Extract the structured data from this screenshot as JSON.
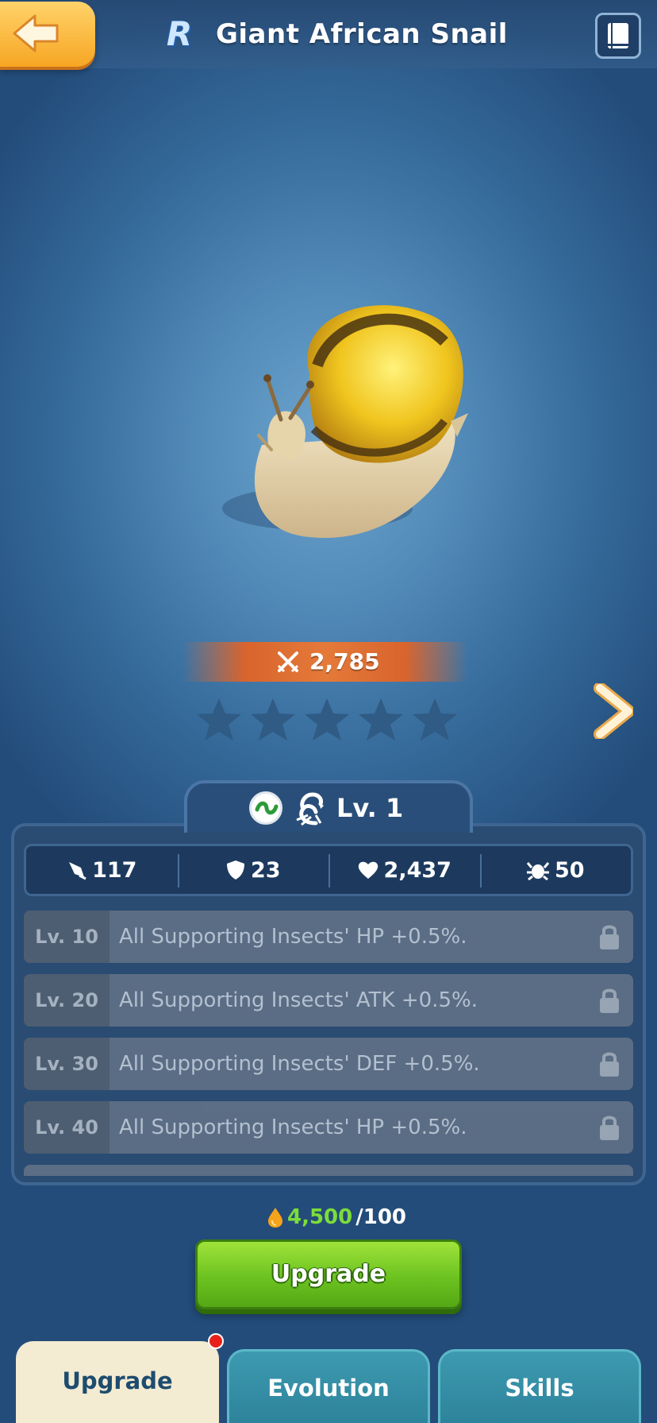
{
  "header": {
    "rarity": "R",
    "title": "Giant African Snail",
    "back_icon": "arrow-left-icon",
    "book_icon": "book-icon"
  },
  "power": {
    "icon": "crossed-swords-icon",
    "value": "2,785"
  },
  "stars": {
    "filled": 0,
    "total": 5
  },
  "level": {
    "label": "Lv. 1",
    "type_icon": "plant-icon",
    "class_icon": "scorpion-icon"
  },
  "stats": [
    {
      "icon": "attack-icon",
      "value": "117"
    },
    {
      "icon": "shield-icon",
      "value": "23"
    },
    {
      "icon": "heart-icon",
      "value": "2,437"
    },
    {
      "icon": "speed-icon",
      "value": "50"
    }
  ],
  "perks": [
    {
      "level": "Lv. 10",
      "desc": "All Supporting Insects' HP +0.5%.",
      "locked": true
    },
    {
      "level": "Lv. 20",
      "desc": "All Supporting Insects' ATK +0.5%.",
      "locked": true
    },
    {
      "level": "Lv. 30",
      "desc": "All Supporting Insects' DEF +0.5%.",
      "locked": true
    },
    {
      "level": "Lv. 40",
      "desc": "All Supporting Insects' HP +0.5%.",
      "locked": true
    }
  ],
  "cost": {
    "have": "4,500",
    "need": "/100",
    "icon": "honey-drop-icon"
  },
  "upgrade_button": "Upgrade",
  "tabs": [
    {
      "label": "Upgrade",
      "active": true,
      "badge": true
    },
    {
      "label": "Evolution",
      "active": false
    },
    {
      "label": "Skills",
      "active": false
    }
  ],
  "colors": {
    "accent_green": "#7ddc3a",
    "power_orange": "#e47a39",
    "tab_teal": "#2a7f97"
  }
}
